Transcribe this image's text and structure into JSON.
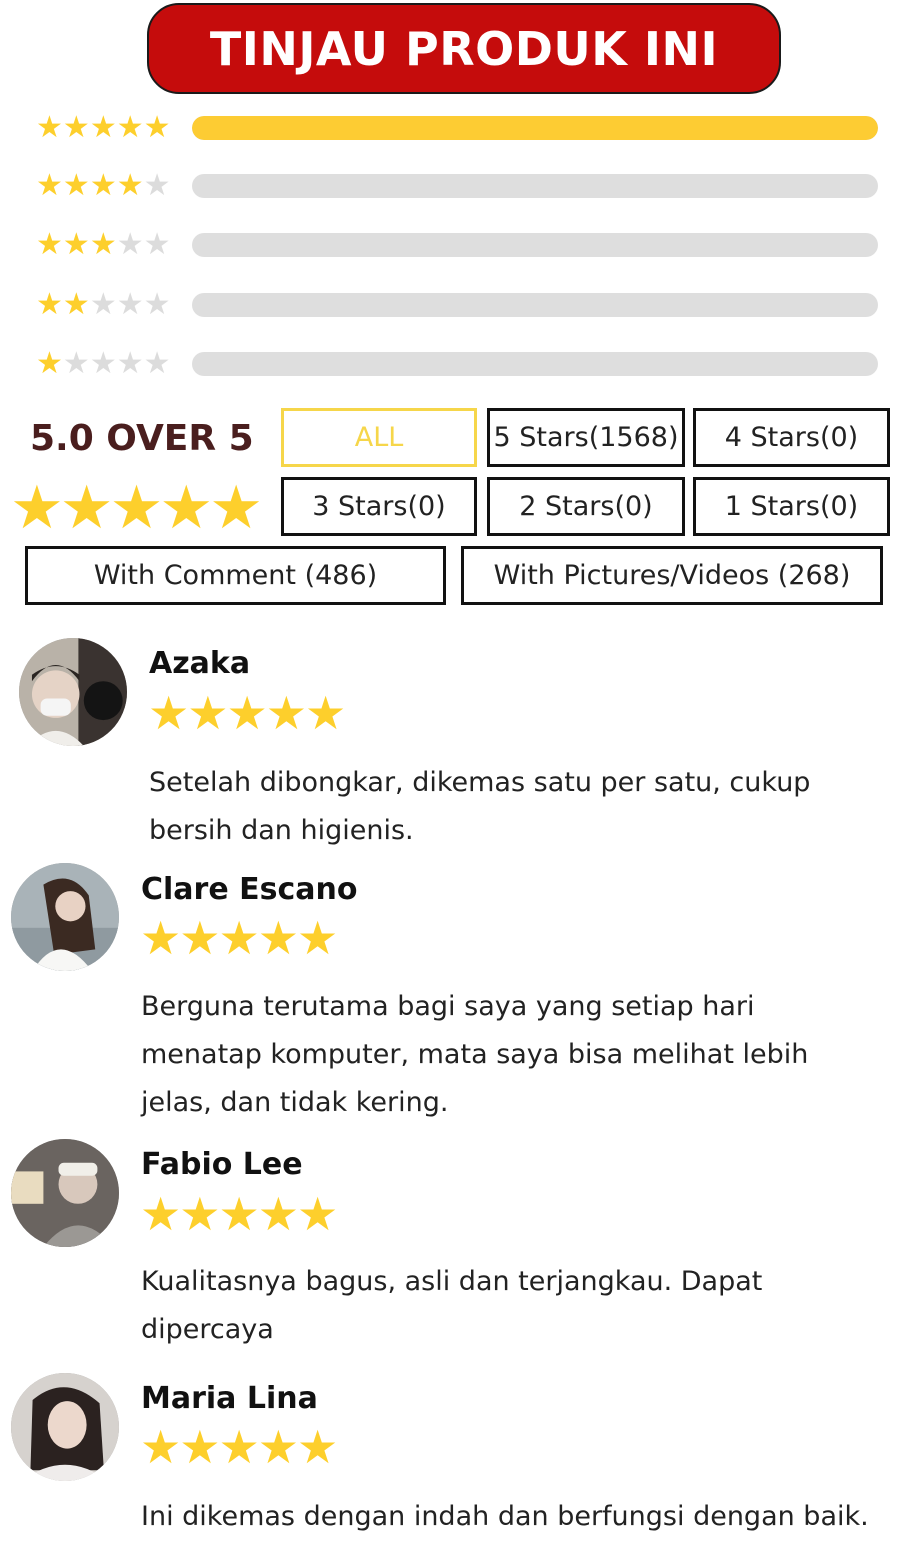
{
  "header": {
    "title": "TINJAU PRODUK INI"
  },
  "distribution": [
    {
      "stars": 5,
      "fill_fraction": 1.0
    },
    {
      "stars": 4,
      "fill_fraction": 0.0
    },
    {
      "stars": 3,
      "fill_fraction": 0.0
    },
    {
      "stars": 2,
      "fill_fraction": 0.0
    },
    {
      "stars": 1,
      "fill_fraction": 0.0
    }
  ],
  "summary": {
    "score_text": "5.0 OVER 5",
    "stars": 5
  },
  "filters": {
    "all": "ALL",
    "five": "5 Stars(1568)",
    "four": "4 Stars(0)",
    "three": "3 Stars(0)",
    "two": "2 Stars(0)",
    "one": "1 Stars(0)",
    "with_comment": "With Comment (486)",
    "with_media": "With Pictures/Videos (268)"
  },
  "reviews": [
    {
      "name": "Azaka",
      "stars": 5,
      "text_line1": "Setelah dibongkar, dikemas satu per satu, cukup",
      "text_line2": "bersih dan higienis.",
      "text_line3": ""
    },
    {
      "name": "Clare Escano",
      "stars": 5,
      "text_line1": "Berguna terutama bagi saya yang setiap hari",
      "text_line2": "menatap komputer, mata saya bisa melihat lebih",
      "text_line3": "jelas, dan tidak kering."
    },
    {
      "name": "Fabio Lee",
      "stars": 5,
      "text_line1": "Kualitasnya bagus, asli dan terjangkau. Dapat",
      "text_line2": "dipercaya",
      "text_line3": ""
    },
    {
      "name": "Maria Lina",
      "stars": 5,
      "text_line1": "Ini dikemas dengan indah dan berfungsi dengan baik.",
      "text_line2": "",
      "text_line3": ""
    }
  ],
  "colors": {
    "banner": "#c50c0c",
    "star": "#fdcf2c",
    "bar_fill": "#fdcc33",
    "bar_track": "#dedede",
    "active_filter": "#f6d64a"
  }
}
